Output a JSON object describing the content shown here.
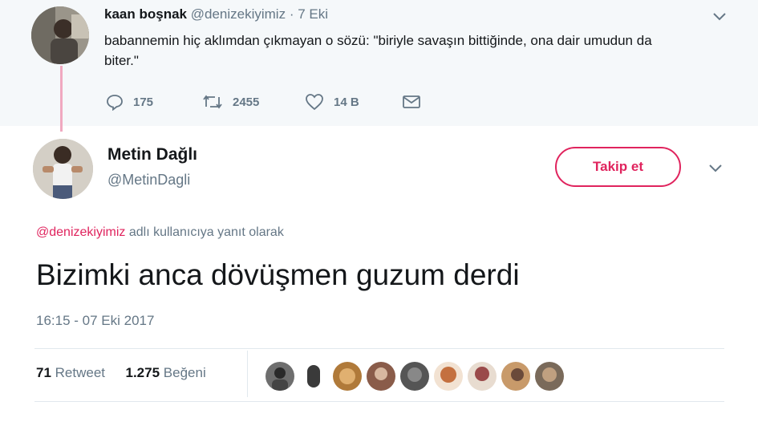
{
  "parent_tweet": {
    "name": "kaan boşnak",
    "handle": "@denizekiyimiz",
    "separator": "·",
    "time": "7 Eki",
    "text": "babannemin hiç aklımdan çıkmayan o sözü: \"biriyle savaşın bittiğinde, ona dair umudun da biter.\"",
    "replies": "175",
    "retweets": "2455",
    "likes": "14 B"
  },
  "main_tweet": {
    "name": "Metin Dağlı",
    "handle": "@MetinDagli",
    "follow_label": "Takip et",
    "reply_mention": "@denizekiyimiz",
    "reply_suffix": " adlı kullanıcıya yanıt olarak",
    "text": "Bizimki anca dövüşmen guzum derdi",
    "timestamp": "16:15 - 07 Eki 2017",
    "retweet_count": "71",
    "retweet_label": "Retweet",
    "like_count": "1.275",
    "like_label": "Beğeni"
  },
  "colors": {
    "accent": "#e0245e",
    "muted": "#657786",
    "thread_line": "#f0a9c0",
    "parent_bg": "#f5f8fa"
  },
  "likers": [
    {
      "color": "#6e6e6e"
    },
    {
      "color": "#3a3a3a"
    },
    {
      "color": "#b07a3a"
    },
    {
      "color": "#8a5c4a"
    },
    {
      "color": "#555555"
    },
    {
      "color": "#c4703f"
    },
    {
      "color": "#9a4a4a"
    },
    {
      "color": "#c89a6a"
    },
    {
      "color": "#7a6a5a"
    }
  ]
}
